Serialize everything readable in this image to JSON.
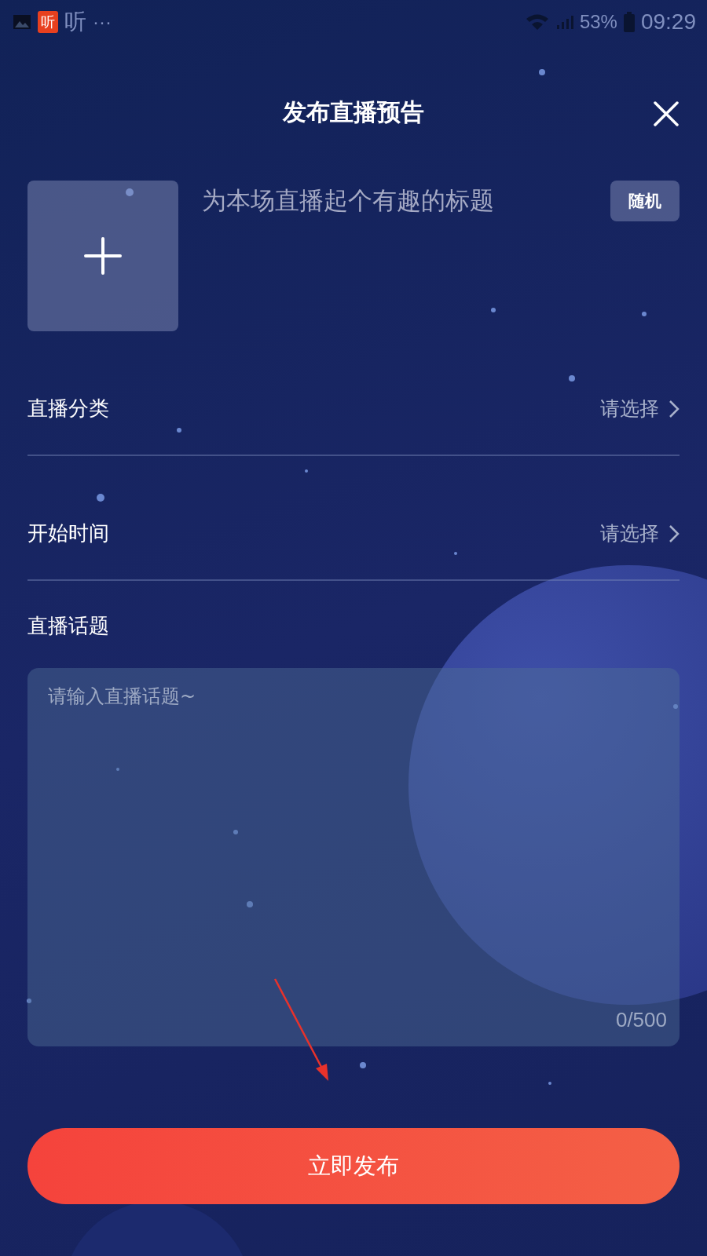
{
  "status_bar": {
    "app_badge": "听",
    "app_name": "听",
    "more": "···",
    "battery": "53%",
    "time": "09:29"
  },
  "header": {
    "title": "发布直播预告"
  },
  "title_field": {
    "placeholder": "为本场直播起个有趣的标题"
  },
  "random_button": "随机",
  "rows": [
    {
      "label": "直播分类",
      "value": "请选择"
    },
    {
      "label": "开始时间",
      "value": "请选择"
    }
  ],
  "topic": {
    "label": "直播话题",
    "placeholder": "请输入直播话题~",
    "counter": "0/500"
  },
  "submit_button": "立即发布"
}
